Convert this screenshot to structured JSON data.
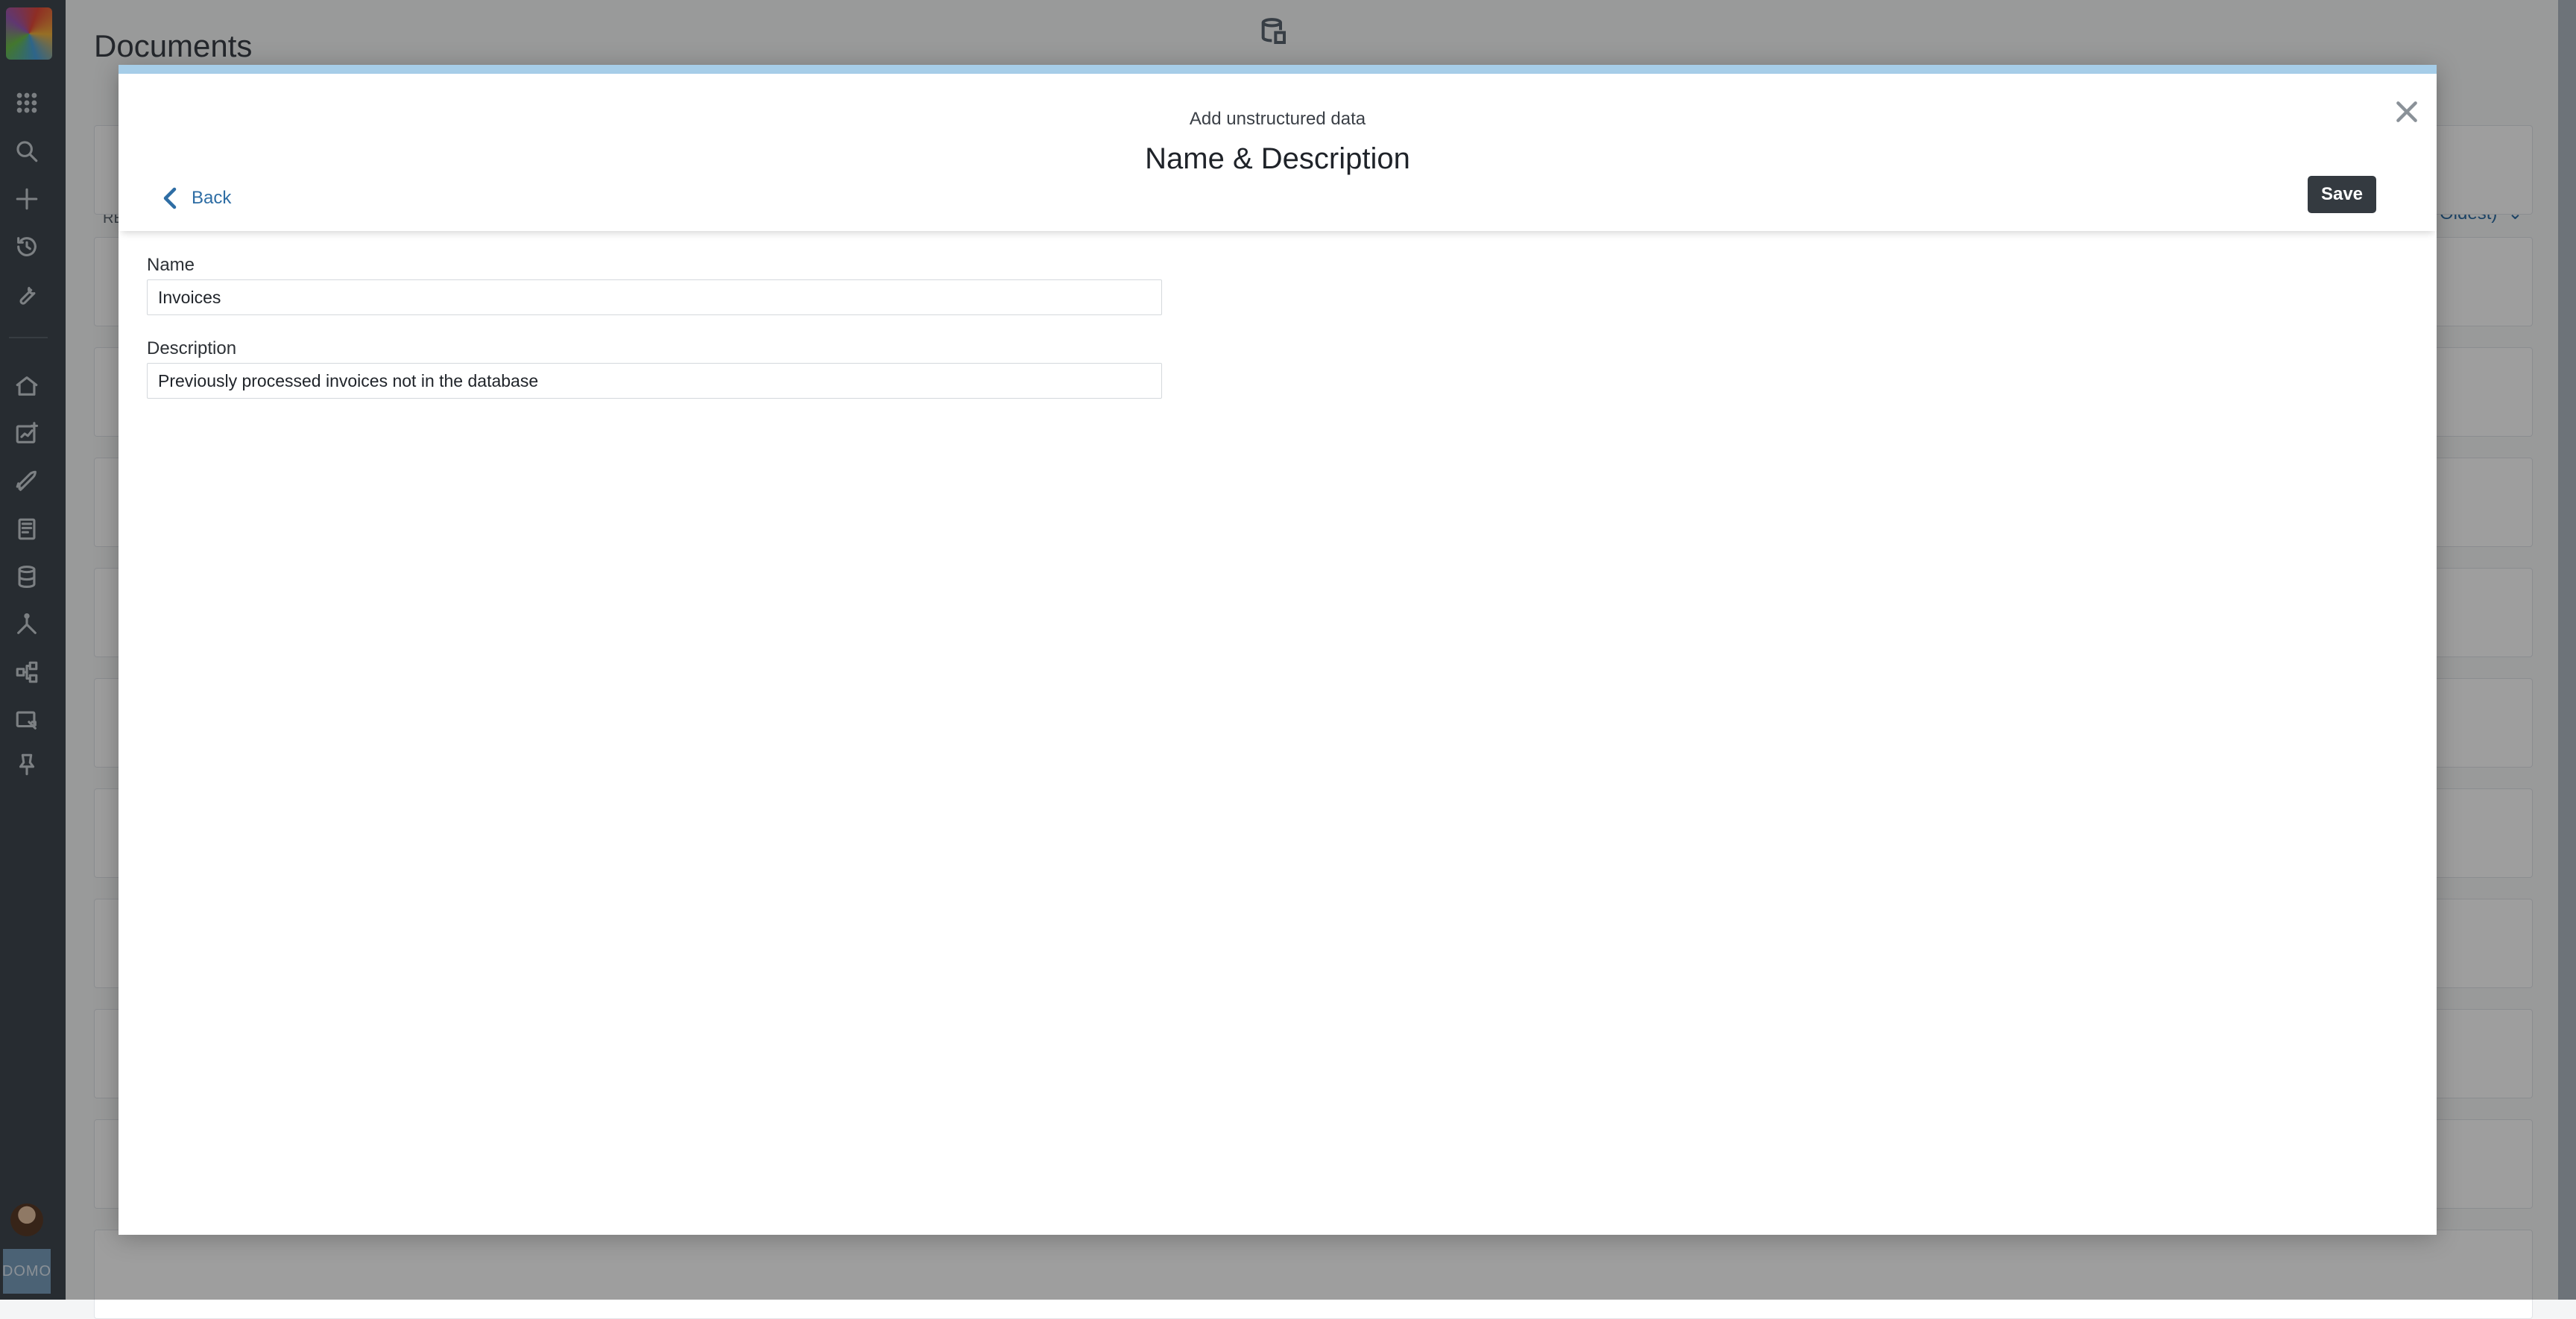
{
  "sidenav": {
    "icons": [
      "apps-grid-icon",
      "search-icon",
      "plus-icon",
      "history-icon",
      "wrench-icon",
      "home-icon",
      "alerts-icon",
      "rocket-icon",
      "pages-icon",
      "database-icon",
      "dataflow-icon",
      "hierarchy-icon",
      "reports-icon",
      "pin-icon"
    ],
    "brand": "DOMO"
  },
  "page": {
    "title": "Documents",
    "sort_label": "o Oldest)",
    "cut_text": "RE"
  },
  "modal": {
    "subtitle": "Add unstructured data",
    "title": "Name & Description",
    "back_label": "Back",
    "save_label": "Save",
    "fields": {
      "name": {
        "label": "Name",
        "value": "Invoices"
      },
      "description": {
        "label": "Description",
        "value": "Previously processed invoices not in the database"
      }
    }
  },
  "colors": {
    "accent": "#2e6da4",
    "modal_topbar": "#a6cde8",
    "sidebar_bg": "#3f4850",
    "save_button": "#343a40"
  }
}
